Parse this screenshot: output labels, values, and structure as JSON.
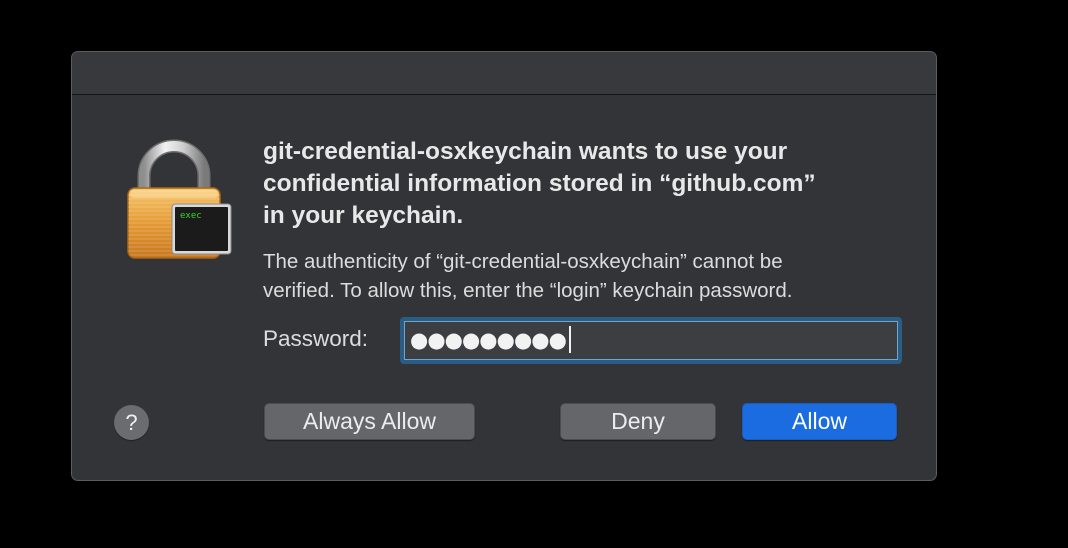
{
  "dialog": {
    "headline": "git-credential-osxkeychain wants to use your\nconfidential information stored in “github.com”\nin your keychain.",
    "detail": "The authenticity of “git-credential-osxkeychain” cannot be\nverified. To allow this, enter the “login” keychain password.",
    "password_label": "Password:",
    "password_value": "●●●●●●●●●",
    "help_label": "?",
    "buttons": {
      "always_allow": "Always Allow",
      "deny": "Deny",
      "allow": "Allow"
    },
    "icon": {
      "name": "keychain-lock-icon",
      "badge_text": "exec"
    }
  },
  "colors": {
    "window_bg": "#323437",
    "accent": "#1a6ce0",
    "focus_ring": "#2a5d86",
    "badge_text": "#38d430"
  }
}
